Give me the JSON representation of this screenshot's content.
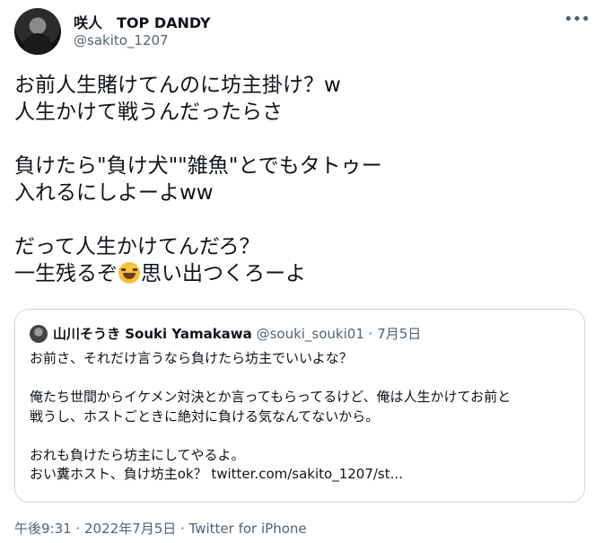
{
  "author": {
    "display_name": "咲人　TOP DANDY",
    "handle": "@sakito_1207"
  },
  "tweet": {
    "lines": [
      "お前人生賭けてんのに坊主掛け？w",
      "人生かけて戦うんだったらさ",
      "",
      "負けたら\"負け犬\"\"雑魚\"とでもタトゥー",
      "入れるにしよーよww",
      "",
      "だって人生かけてんだろ？"
    ],
    "last_line_before": "一生残るぞ",
    "last_line_emoji": "face-with-tears-of-joy-emoji",
    "last_line_after": "思い出つくろーよ"
  },
  "quoted": {
    "display_name": "山川そうき Souki Yamakawa",
    "handle": "@souki_souki01",
    "separator": " · ",
    "date": "7月5日",
    "lines": [
      "お前さ、それだけ言うなら負けたら坊主でいいよな？",
      "",
      "俺たち世間からイケメン対決とか言ってもらってるけど、俺は人生かけてお前と",
      "戦うし、ホストごときに絶対に負ける気なんてないから。",
      "",
      "おれも負けたら坊主にしてやるよ。",
      "おい糞ホスト、負け坊主ok？ twitter.com/sakito_1207/st..."
    ]
  },
  "meta": {
    "text": "午後9:31 · 2022年7月5日 · Twitter for iPhone"
  },
  "icons": {
    "more": "more-options-icon"
  }
}
